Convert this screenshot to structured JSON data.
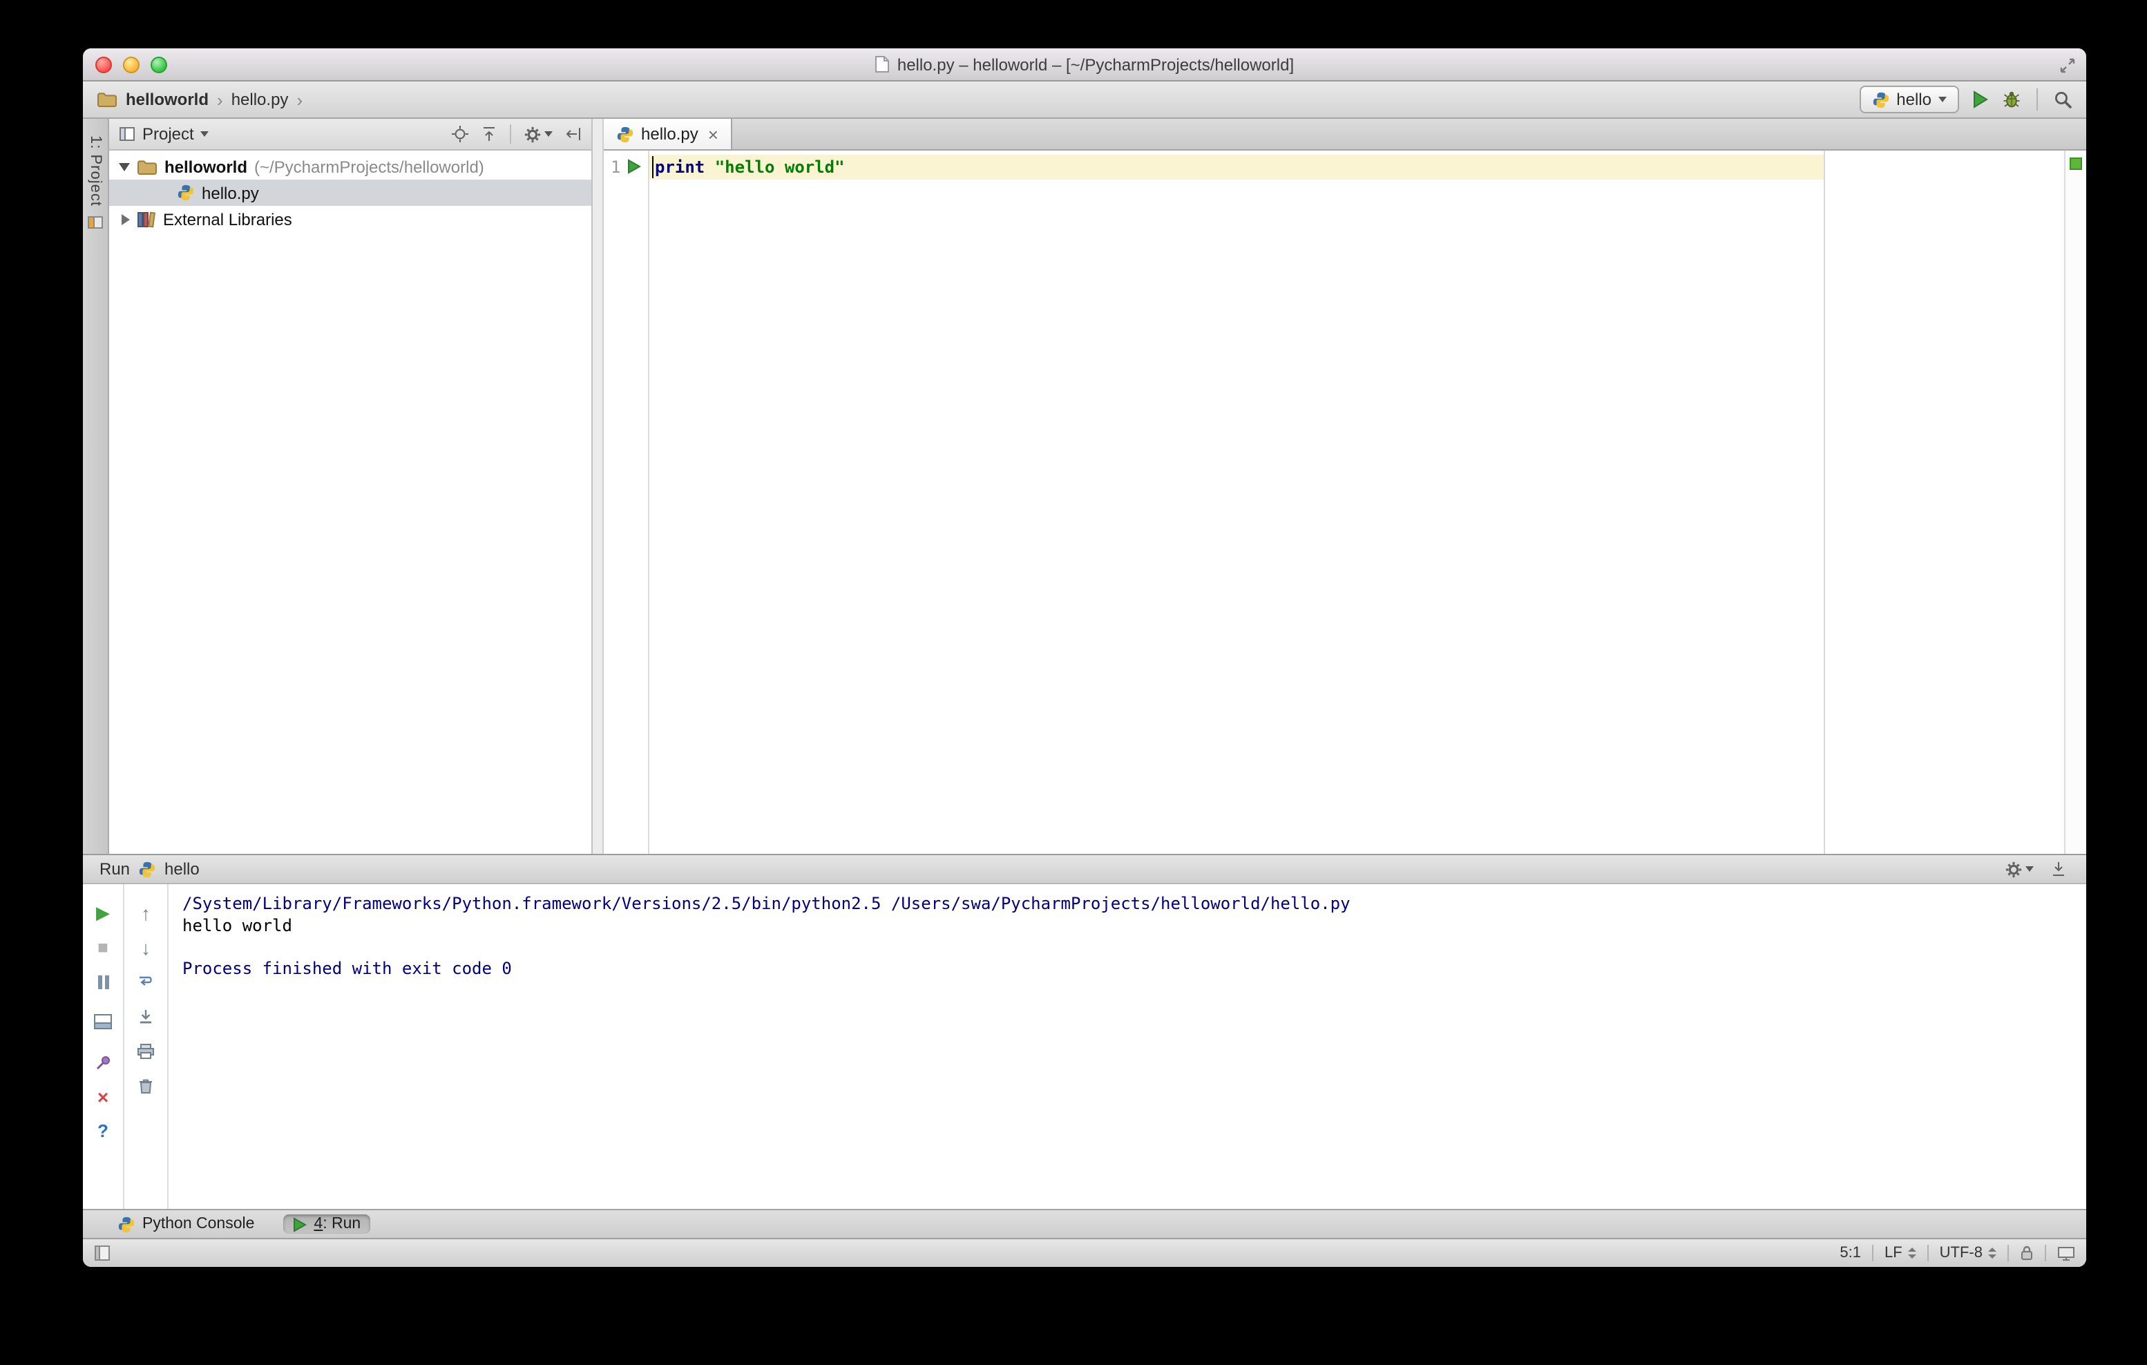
{
  "window": {
    "title": "hello.py – helloworld – [~/PycharmProjects/helloworld]"
  },
  "navbar": {
    "breadcrumb": [
      {
        "label": "helloworld"
      },
      {
        "label": "hello.py"
      }
    ],
    "separator": "›",
    "run_config_label": "hello"
  },
  "tool_strip": {
    "project_button_label": "1: Project"
  },
  "project_panel": {
    "header_label": "Project",
    "tree": [
      {
        "label": "helloworld",
        "detail": " (~/PycharmProjects/helloworld)"
      },
      {
        "label": "hello.py"
      },
      {
        "label": "External Libraries"
      }
    ]
  },
  "editor": {
    "tab_label": "hello.py",
    "tab_close_glyph": "×",
    "line_number": "1",
    "code": {
      "keyword": "print",
      "string": "\"hello world\""
    }
  },
  "run_panel": {
    "title": "Run",
    "config_label": "hello",
    "console": [
      {
        "text": "/System/Library/Frameworks/Python.framework/Versions/2.5/bin/python2.5 /Users/swa/PycharmProjects/helloworld/hello.py",
        "kind": "system"
      },
      {
        "text": "hello world",
        "kind": "stdout"
      },
      {
        "text": "",
        "kind": "stdout"
      },
      {
        "text": "Process finished with exit code 0",
        "kind": "system"
      }
    ],
    "toolbar_glyphs": {
      "rerun": "▶",
      "stop": "■",
      "up": "↑",
      "down": "↓",
      "close": "×",
      "help": "?"
    }
  },
  "bottom_bar": {
    "python_console_label": "Python Console",
    "run_tab_mnemonic": "4",
    "run_tab_rest": ": Run"
  },
  "status_bar": {
    "caret_position": "5:1",
    "line_separator": "LF",
    "encoding": "UTF-8"
  },
  "colors": {
    "keyword": "#000080",
    "string": "#008000",
    "console_system": "#000080",
    "run_green": "#3fa33f",
    "inspection_ok_green": "#5cb83c",
    "current_line_highlight": "#fbf4d2",
    "selection_gray": "#d2d6da"
  }
}
